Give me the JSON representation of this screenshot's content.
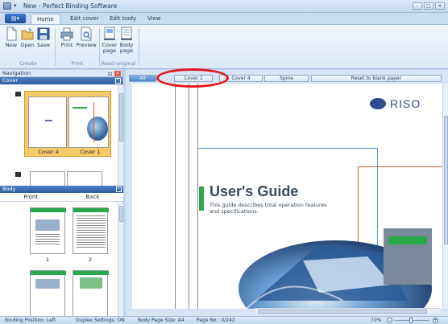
{
  "window": {
    "title": "New - Perfect Binding Software",
    "quick_access": "▾",
    "min": "–",
    "max": "□",
    "close": "×"
  },
  "ribbon": {
    "tabs": [
      "Home",
      "Edit cover",
      "Edit body",
      "View"
    ],
    "active_tab": "Home",
    "buttons": {
      "new": "New",
      "open": "Open",
      "save": "Save",
      "print": "Print",
      "preview": "Preview",
      "cover_page": "Cover page",
      "body_page": "Body page"
    },
    "groups": {
      "create": "Create",
      "print": "Print",
      "read_original": "Read original"
    }
  },
  "navigation": {
    "title": "Navigation",
    "pin": "⊟",
    "close": "×",
    "cover_section": "Cover",
    "cover_labels": [
      "Cover 4",
      "Cover 1"
    ],
    "body_section": "Body",
    "body_columns": [
      "Front",
      "Back"
    ],
    "body_page_numbers": [
      "1",
      "2"
    ],
    "collapse": "–"
  },
  "main": {
    "header_buttons": [
      "All",
      "Cover 1",
      "Cover 4",
      "Spine",
      "Reset to blank paper"
    ],
    "selected": "Cover 1",
    "cover": {
      "brand": "RISO",
      "heading": "User's Guide",
      "subtitle_line1": "This guide describes total operation features",
      "subtitle_line2": "and specifications."
    }
  },
  "status": {
    "binding": "Binding Position: Left",
    "duplex": "Duplex Settings: ON",
    "size": "Body Page Size: A4",
    "page": "Page No.: 0/242",
    "zoom": "70%",
    "zoom_out": "–",
    "zoom_in": "+"
  },
  "colors": {
    "accent_blue": "#2f5ea2",
    "cover_green": "#2aa84a",
    "line_blue": "#5a9fd8",
    "line_orange": "#e0562b",
    "highlight_red": "#e2161c"
  }
}
